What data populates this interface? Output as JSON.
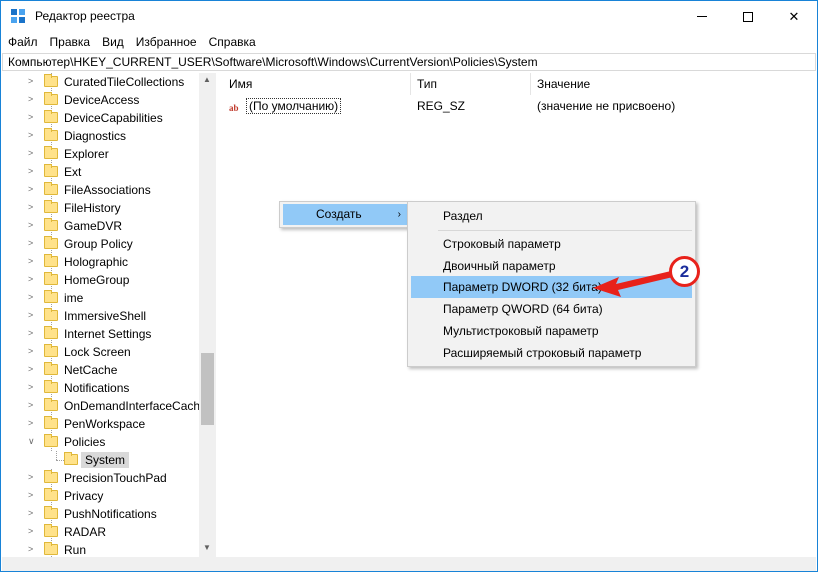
{
  "window": {
    "title": "Редактор реестра",
    "icon": "registry-editor-icon",
    "controls": [
      "minimize",
      "maximize",
      "close"
    ],
    "close_glyph": "✕"
  },
  "menubar": [
    "Файл",
    "Правка",
    "Вид",
    "Избранное",
    "Справка"
  ],
  "address": "Компьютер\\HKEY_CURRENT_USER\\Software\\Microsoft\\Windows\\CurrentVersion\\Policies\\System",
  "tree": {
    "items": [
      {
        "label": "CuratedTileCollections",
        "state": "collapsed"
      },
      {
        "label": "DeviceAccess",
        "state": "collapsed"
      },
      {
        "label": "DeviceCapabilities",
        "state": "collapsed"
      },
      {
        "label": "Diagnostics",
        "state": "collapsed"
      },
      {
        "label": "Explorer",
        "state": "collapsed"
      },
      {
        "label": "Ext",
        "state": "collapsed"
      },
      {
        "label": "FileAssociations",
        "state": "collapsed"
      },
      {
        "label": "FileHistory",
        "state": "collapsed"
      },
      {
        "label": "GameDVR",
        "state": "collapsed"
      },
      {
        "label": "Group Policy",
        "state": "collapsed"
      },
      {
        "label": "Holographic",
        "state": "collapsed"
      },
      {
        "label": "HomeGroup",
        "state": "collapsed"
      },
      {
        "label": "ime",
        "state": "collapsed"
      },
      {
        "label": "ImmersiveShell",
        "state": "collapsed"
      },
      {
        "label": "Internet Settings",
        "state": "collapsed"
      },
      {
        "label": "Lock Screen",
        "state": "collapsed"
      },
      {
        "label": "NetCache",
        "state": "collapsed"
      },
      {
        "label": "Notifications",
        "state": "collapsed"
      },
      {
        "label": "OnDemandInterfaceCach",
        "state": "collapsed"
      },
      {
        "label": "PenWorkspace",
        "state": "collapsed"
      },
      {
        "label": "Policies",
        "state": "expanded"
      },
      {
        "label": "System",
        "state": "selected-child"
      },
      {
        "label": "PrecisionTouchPad",
        "state": "collapsed"
      },
      {
        "label": "Privacy",
        "state": "collapsed"
      },
      {
        "label": "PushNotifications",
        "state": "collapsed"
      },
      {
        "label": "RADAR",
        "state": "collapsed"
      },
      {
        "label": "Run",
        "state": "collapsed"
      }
    ]
  },
  "list": {
    "columns": [
      "Имя",
      "Тип",
      "Значение"
    ],
    "rows": [
      {
        "name": "(По умолчанию)",
        "type": "REG_SZ",
        "value": "(значение не присвоено)",
        "icon": "ab-string-icon",
        "icon_text": "ab"
      }
    ]
  },
  "context_menu": {
    "create_label": "Создать",
    "create_arrow": "›",
    "submenu": [
      {
        "label": "Раздел",
        "highlighted": false
      },
      {
        "label": "Строковый параметр",
        "highlighted": false
      },
      {
        "label": "Двоичный параметр",
        "highlighted": false
      },
      {
        "label": "Параметр DWORD (32 бита)",
        "highlighted": true
      },
      {
        "label": "Параметр QWORD (64 бита)",
        "highlighted": false
      },
      {
        "label": "Мультистроковый параметр",
        "highlighted": false
      },
      {
        "label": "Расширяемый строковый параметр",
        "highlighted": false
      }
    ]
  },
  "annotation": {
    "badge_number": "2",
    "colors": {
      "ring": "#e8221b",
      "digit": "#1b2d9c",
      "arrow": "#e8221b"
    }
  },
  "colors": {
    "highlight": "#91c9f7",
    "menu_bg": "#f2f2f2",
    "folder": "#ffe28a",
    "frame": "#1883d7"
  }
}
